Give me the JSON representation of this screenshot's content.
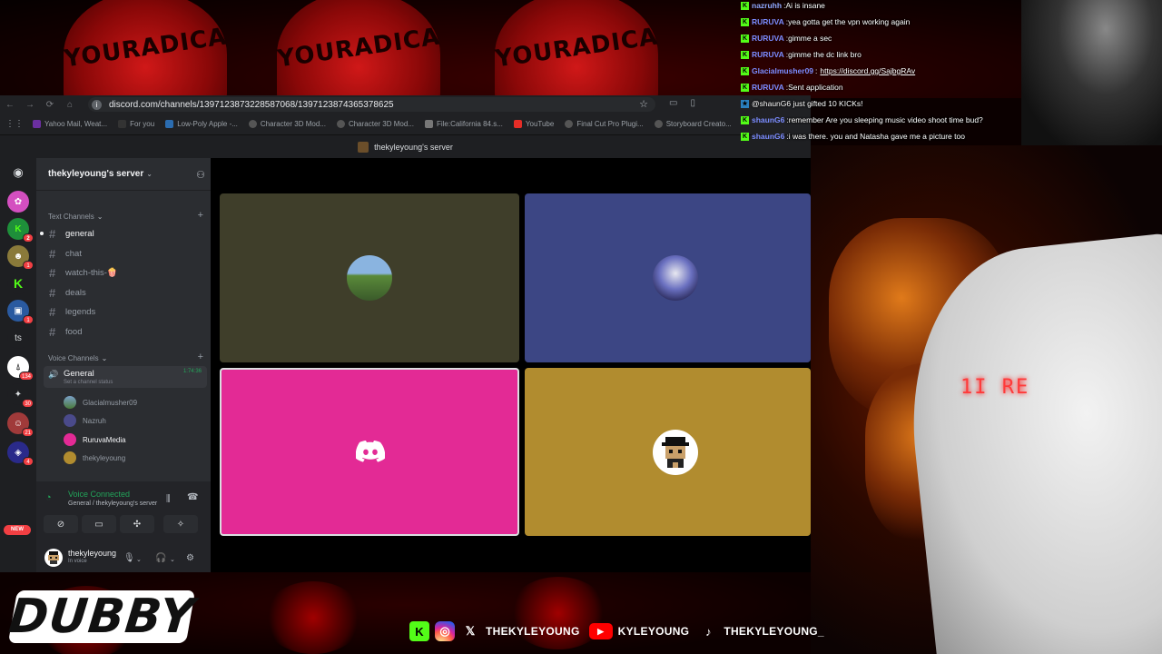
{
  "browser": {
    "url": "discord.com/channels/1397123873228587068/1397123874365378625",
    "bookmarks": [
      "Yahoo Mail, Weat...",
      "For you",
      "Low-Poly Apple -...",
      "Character 3D Mod...",
      "Character 3D Mod...",
      "File:California 84.s...",
      "YouTube",
      "Final Cut Pro Plugi...",
      "Storyboard Creato..."
    ]
  },
  "discord": {
    "window_title": "thekyleyoung's server",
    "server_name": "thekyleyoung's server",
    "rail_badges": [
      "2",
      "1",
      "1",
      "134",
      "30",
      "21",
      "4"
    ],
    "rail_ts": "ts",
    "rail_new": "NEW",
    "text_category": "Text Channels",
    "text_channels": [
      "general",
      "chat",
      "watch-this-🍿",
      "deals",
      "legends",
      "food"
    ],
    "voice_category": "Voice Channels",
    "voice_channel": {
      "name": "General",
      "timer": "1:74:36",
      "status": "Set a channel status"
    },
    "voice_users": [
      "Glacialmusher09",
      "Nazruh",
      "RuruvaMedia",
      "thekyleyoung"
    ],
    "voice_panel": {
      "title": "Voice Connected",
      "subtitle": "General / thekyleyoung's server"
    },
    "user": {
      "name": "thekyleyoung",
      "status": "In voice"
    }
  },
  "stage": {
    "tile_colors": [
      "#3f3e2a",
      "#3c4684",
      "#e32a95",
      "#b18c2f"
    ]
  },
  "chat": [
    {
      "user": "nazruhh",
      "color": "#8fa8ff",
      "msg": "Ai is insane"
    },
    {
      "user": "RURUVA",
      "color": "#7b8cff",
      "msg": "yea gotta get the vpn working again"
    },
    {
      "user": "RURUVA",
      "color": "#7b8cff",
      "msg": "gimme a sec"
    },
    {
      "user": "RURUVA",
      "color": "#7b8cff",
      "msg": "gimme the dc link bro"
    },
    {
      "user": "Glacialmusher09",
      "color": "#7b8cff",
      "msg": "",
      "link": "https://discord.gg/SajbgRAv"
    },
    {
      "user": "RURUVA",
      "color": "#7b8cff",
      "msg": "Sent application"
    },
    {
      "user": "",
      "color": "#7b8cff",
      "msg": "@shaunG6 just gifted 10 KICKs!"
    },
    {
      "user": "shaunG6",
      "color": "#7b8cff",
      "msg": "remember Are you sleeping music video shoot time bud?"
    },
    {
      "user": "shaunG6",
      "color": "#7b8cff",
      "msg": "i was there. you and Natasha gave me a picture too"
    }
  ],
  "overlay": {
    "hat_text": "YOURADICA",
    "led_text": "1I RE",
    "brand": "DUBBY",
    "socials": [
      {
        "icon": "kick-icon",
        "label": ""
      },
      {
        "icon": "instagram-icon",
        "label": ""
      },
      {
        "icon": "x-icon",
        "label": "THEKYLEYOUNG"
      },
      {
        "icon": "youtube-icon",
        "label": "KYLEYOUNG"
      },
      {
        "icon": "tiktok-icon",
        "label": "THEKYLEYOUNG_"
      }
    ]
  }
}
